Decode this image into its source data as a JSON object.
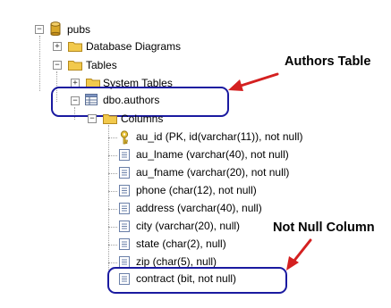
{
  "tree": {
    "database": "pubs",
    "database_diagrams": "Database Diagrams",
    "tables": "Tables",
    "system_tables": "System Tables",
    "table_name": "dbo.authors",
    "columns_folder": "Columns",
    "columns": [
      "au_id (PK, id(varchar(11)), not null)",
      "au_lname (varchar(40), not null)",
      "au_fname (varchar(20), not null)",
      "phone (char(12), not null)",
      "address (varchar(40), null)",
      "city (varchar(20), null)",
      "state (char(2), null)",
      "zip (char(5), null)",
      "contract (bit, not null)"
    ],
    "toggles": {
      "expanded": "−",
      "collapsed": "+"
    }
  },
  "annotations": {
    "authors_table": "Authors Table",
    "not_null_column": "Not Null Column"
  },
  "colors": {
    "highlight_ring": "#1a1aa0",
    "arrow": "#d42020",
    "folder": "#f2c94c",
    "database": "#d9a82a"
  }
}
